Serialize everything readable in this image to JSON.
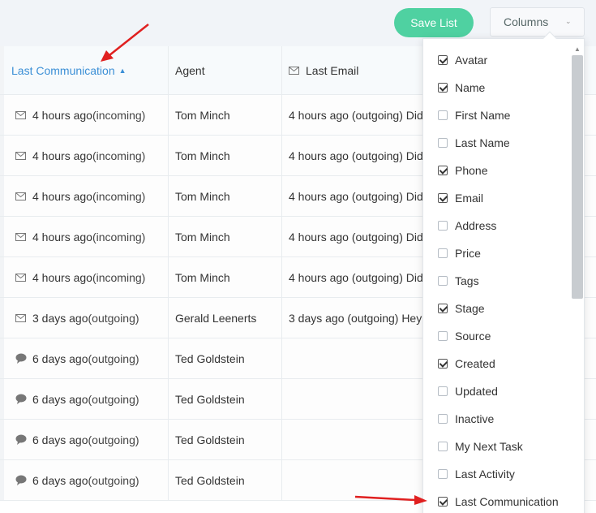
{
  "toolbar": {
    "save_label": "Save List",
    "columns_label": "Columns"
  },
  "headers": {
    "last_communication": "Last Communication",
    "agent": "Agent",
    "last_email": "Last Email"
  },
  "rows": [
    {
      "icon": "email-icon",
      "time": "4 hours ago",
      "direction": "(incoming)",
      "agent": "Tom Minch",
      "last_email": "4 hours ago (outgoing) Did"
    },
    {
      "icon": "email-icon",
      "time": "4 hours ago",
      "direction": "(incoming)",
      "agent": "Tom Minch",
      "last_email": "4 hours ago (outgoing) Did"
    },
    {
      "icon": "email-icon",
      "time": "4 hours ago",
      "direction": "(incoming)",
      "agent": "Tom Minch",
      "last_email": "4 hours ago (outgoing) Did"
    },
    {
      "icon": "email-icon",
      "time": "4 hours ago",
      "direction": "(incoming)",
      "agent": "Tom Minch",
      "last_email": "4 hours ago (outgoing) Did"
    },
    {
      "icon": "email-icon",
      "time": "4 hours ago",
      "direction": "(incoming)",
      "agent": "Tom Minch",
      "last_email": "4 hours ago (outgoing) Did"
    },
    {
      "icon": "email-icon",
      "time": "3 days ago",
      "direction": "(outgoing)",
      "agent": "Gerald Leenerts",
      "last_email": "3 days ago (outgoing) Hey"
    },
    {
      "icon": "chat-bubble-icon",
      "time": "6 days ago",
      "direction": "(outgoing)",
      "agent": "Ted Goldstein",
      "last_email": ""
    },
    {
      "icon": "chat-bubble-icon",
      "time": "6 days ago",
      "direction": "(outgoing)",
      "agent": "Ted Goldstein",
      "last_email": ""
    },
    {
      "icon": "chat-bubble-icon",
      "time": "6 days ago",
      "direction": "(outgoing)",
      "agent": "Ted Goldstein",
      "last_email": ""
    },
    {
      "icon": "chat-bubble-icon",
      "time": "6 days ago",
      "direction": "(outgoing)",
      "agent": "Ted Goldstein",
      "last_email": ""
    }
  ],
  "columns_menu": [
    {
      "label": "Avatar",
      "checked": true
    },
    {
      "label": "Name",
      "checked": true
    },
    {
      "label": "First Name",
      "checked": false
    },
    {
      "label": "Last Name",
      "checked": false
    },
    {
      "label": "Phone",
      "checked": true
    },
    {
      "label": "Email",
      "checked": true
    },
    {
      "label": "Address",
      "checked": false
    },
    {
      "label": "Price",
      "checked": false
    },
    {
      "label": "Tags",
      "checked": false
    },
    {
      "label": "Stage",
      "checked": true
    },
    {
      "label": "Source",
      "checked": false
    },
    {
      "label": "Created",
      "checked": true
    },
    {
      "label": "Updated",
      "checked": false
    },
    {
      "label": "Inactive",
      "checked": false
    },
    {
      "label": "My Next Task",
      "checked": false
    },
    {
      "label": "Last Activity",
      "checked": false
    },
    {
      "label": "Last Communication",
      "checked": true
    }
  ],
  "colors": {
    "accent": "#4fd1a1",
    "link": "#3b8fd6",
    "annotation": "#e02020"
  }
}
